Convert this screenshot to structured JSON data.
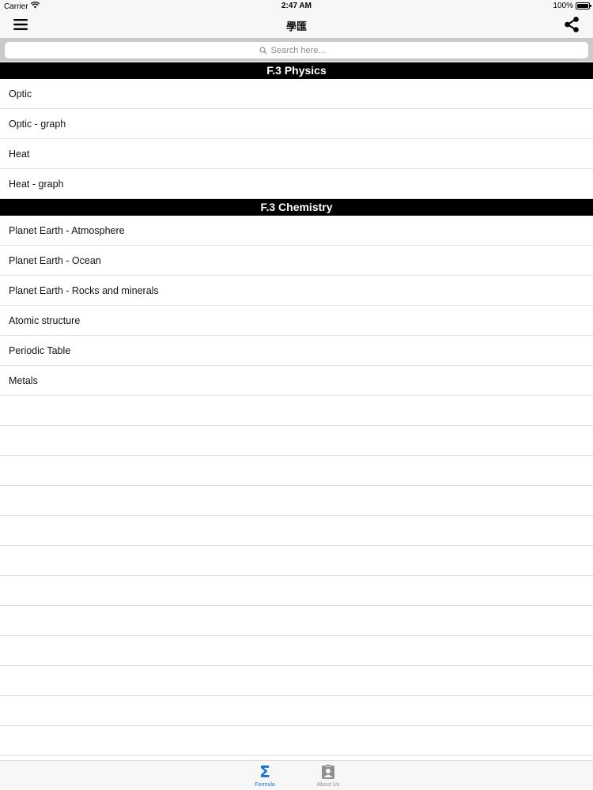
{
  "status_bar": {
    "carrier": "Carrier",
    "time": "2:47 AM",
    "battery": "100%",
    "battery_level": 1.0
  },
  "nav": {
    "title": "學匯",
    "menu_icon": "hamburger-menu-icon",
    "share_icon": "share-icon"
  },
  "search": {
    "placeholder": "Search here..."
  },
  "sections": [
    {
      "header": "F.3 Physics",
      "items": [
        "Optic",
        "Optic - graph",
        "Heat",
        "Heat - graph"
      ]
    },
    {
      "header": "F.3 Chemistry",
      "items": [
        "Planet Earth - Atmosphere",
        "Planet Earth - Ocean",
        "Planet Earth - Rocks and minerals",
        "Atomic structure",
        "Periodic Table",
        "Metals"
      ]
    }
  ],
  "tabs": [
    {
      "label": "Formula",
      "icon": "sigma-icon",
      "active": true
    },
    {
      "label": "About Us",
      "icon": "contact-card-icon",
      "active": false
    }
  ],
  "colors": {
    "accent": "#1a73d9",
    "section_header_bg": "#000000",
    "bar_bg": "#f7f7f7"
  }
}
